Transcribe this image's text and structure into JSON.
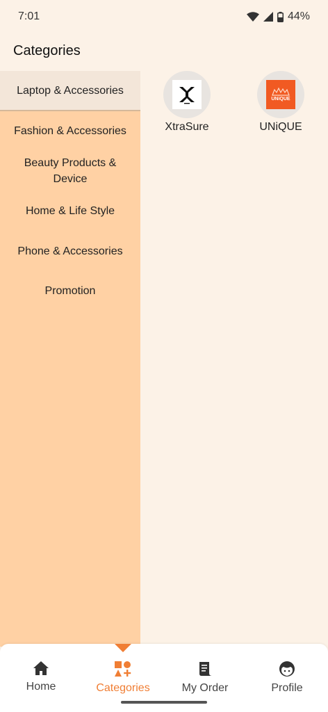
{
  "status_bar": {
    "time": "7:01",
    "battery": "44%",
    "icons": [
      "wifi-icon",
      "signal-icon",
      "battery-icon"
    ]
  },
  "page": {
    "title": "Categories"
  },
  "sidebar": {
    "items": [
      {
        "label": "Laptop & Accessories",
        "active": true
      },
      {
        "label": "Fashion & Accessories",
        "active": false
      },
      {
        "label": "Beauty Products & Device",
        "active": false
      },
      {
        "label": "Home & Life Style",
        "active": false
      },
      {
        "label": "Phone & Accessories",
        "active": false
      },
      {
        "label": "Promotion",
        "active": false
      }
    ]
  },
  "brands": [
    {
      "name": "XtraSure",
      "logo": "xtrasure-logo"
    },
    {
      "name": "UNiQUE",
      "logo": "unique-logo",
      "logo_text": "UNiQUE"
    }
  ],
  "bottom_nav": {
    "items": [
      {
        "label": "Home",
        "icon": "home-icon"
      },
      {
        "label": "Categories",
        "icon": "categories-icon",
        "active": true
      },
      {
        "label": "My Order",
        "icon": "order-icon"
      },
      {
        "label": "Profile",
        "icon": "profile-icon"
      }
    ]
  },
  "colors": {
    "accent": "#f07e34",
    "sidebar_bg": "#ffd1a4",
    "active_item_bg": "#f3e6d9",
    "page_bg": "#fcf2e7",
    "unique_logo_bg": "#f15a22"
  }
}
